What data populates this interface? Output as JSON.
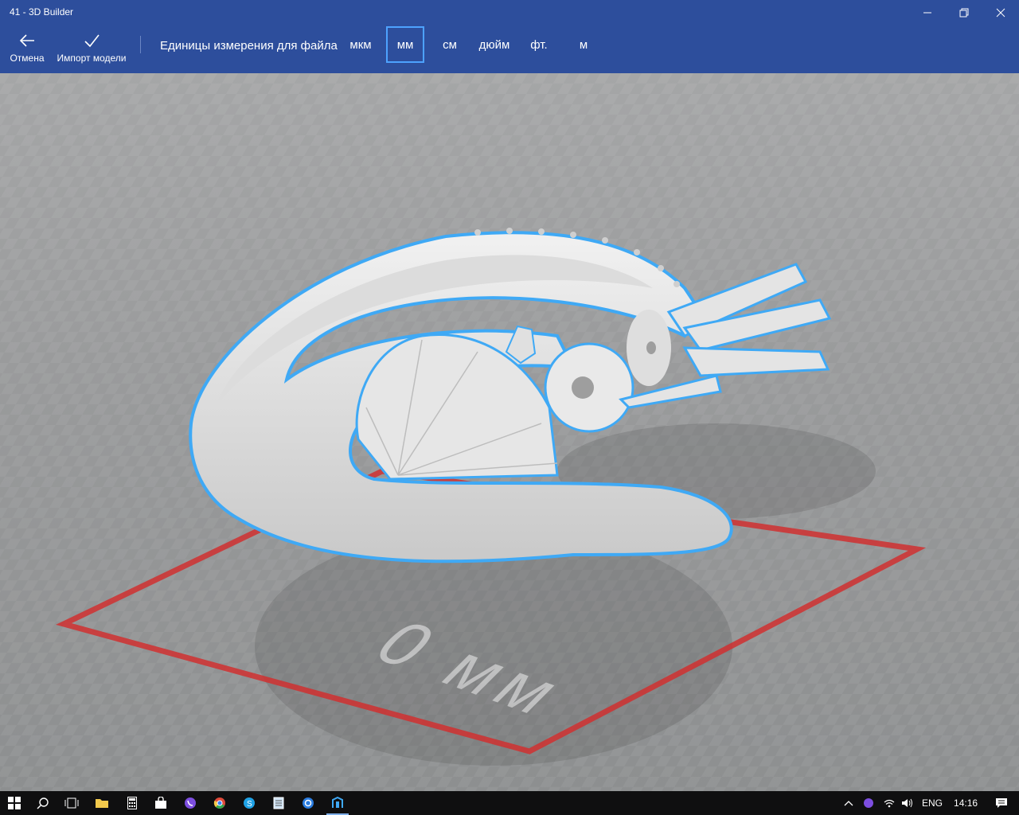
{
  "window": {
    "title": "41 - 3D Builder"
  },
  "toolbar": {
    "cancel_label": "Отмена",
    "import_label": "Импорт модели",
    "units_label": "Единицы измерения для файла",
    "units": [
      "мкм",
      "мм",
      "см",
      "дюйм",
      "фт.",
      "м"
    ],
    "selected_unit": "мм"
  },
  "viewport": {
    "plate_label": "0 мм"
  },
  "taskbar": {
    "language": "ENG",
    "time": "14:16"
  },
  "colors": {
    "accent": "#2d4e9c",
    "selection_outline": "#3fa9f5",
    "build_plate_border": "#d03030"
  }
}
